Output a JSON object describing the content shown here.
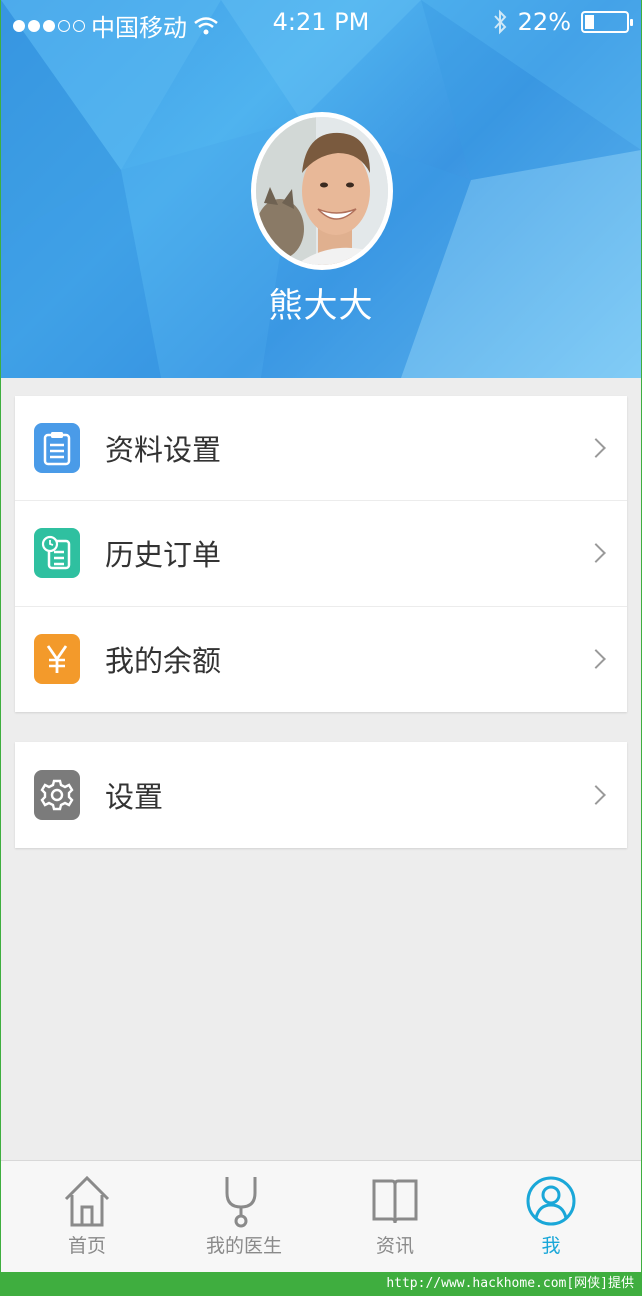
{
  "status_bar": {
    "carrier": "中国移动",
    "time": "4:21 PM",
    "battery": "22%",
    "battery_level": 0.22
  },
  "profile": {
    "username": "熊大大"
  },
  "menu_group_1": [
    {
      "label": "资料设置",
      "icon": "clipboard-icon",
      "color": "#4a9be8"
    },
    {
      "label": "历史订单",
      "icon": "order-history-icon",
      "color": "#2fc0a0"
    },
    {
      "label": "我的余额",
      "icon": "yen-icon",
      "color": "#f39a2b"
    }
  ],
  "menu_group_2": [
    {
      "label": "设置",
      "icon": "gear-icon",
      "color": "#7b7b7b"
    }
  ],
  "tabs": [
    {
      "label": "首页",
      "icon": "home-icon",
      "active": false
    },
    {
      "label": "我的医生",
      "icon": "stethoscope-icon",
      "active": false
    },
    {
      "label": "资讯",
      "icon": "book-icon",
      "active": false
    },
    {
      "label": "我",
      "icon": "user-icon",
      "active": true
    }
  ],
  "accent_color": "#1aa7d8",
  "watermark": "http://www.hackhome.com[网侠]提供"
}
